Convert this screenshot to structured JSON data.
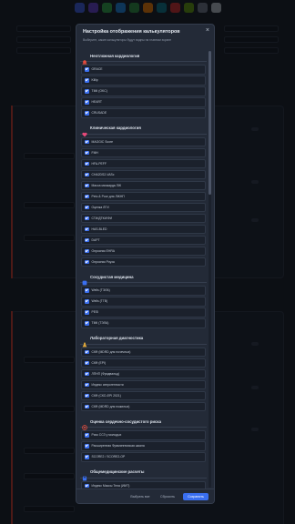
{
  "modal": {
    "title": "Настройка отображения калькуляторов",
    "subtitle": "Выберите, какие калькуляторы будут видны на главном экране",
    "close_symbol": "×"
  },
  "sections": [
    {
      "title": "Неотложная кардиология",
      "icon": "siren-icon",
      "icon_color": "#e74c3c",
      "items": [
        "GRACE",
        "Killip",
        "TIMI (OKC)",
        "HEART",
        "CRUSADE"
      ]
    },
    {
      "title": "Клиническая кардиология",
      "icon": "heart-icon",
      "icon_color": "#e84a7a",
      "items": [
        "MAGGIC Score",
        "FMH",
        "HFA-PEFF",
        "CHA2DS2-VASc",
        "Масса миокарда ЛЖ",
        "Peto & Poor для ЛЖНП",
        "Оценка ЛГИ",
        "СТИ/ДТКИ/ФИ",
        "HAS-BLED",
        "DAPT",
        "Опросник EHRA",
        "Опросник Роуза"
      ]
    },
    {
      "title": "Сосудистая медицина",
      "icon": "vessel-icon",
      "icon_color": "#3a6ff0",
      "items": [
        "Wells (ТЭЛА)",
        "Wells (ТГВ)",
        "PESI",
        "TIMI (ТЭЛА)"
      ]
    },
    {
      "title": "Лабораторная диагностика",
      "icon": "flask-icon",
      "icon_color": "#e0a83b",
      "items": [
        "СКФ (MDRD для почечных)",
        "СКФ (EPI)",
        "ЛПНП (Фридвальд)",
        "Индекс атерогенности",
        "СКФ (CKD-EPI 2021)",
        "СКФ (MDRD для пожилых)"
      ]
    },
    {
      "title": "Оценка сердечно-сосудистого риска",
      "icon": "target-icon",
      "icon_color": "#e74c3c",
      "items": [
        "Риск ССЗ у молодых",
        "Расширенная Фрамингемская шкала",
        "SCORE2 / SCORE2-OP"
      ]
    },
    {
      "title": "Общемедицинские расчеты",
      "icon": "calc-icon",
      "icon_color": "#3a6ff0",
      "items": [
        "Индекс Массы Тела (ИМТ)",
        "Площадь Поверхности Тела (ППТ)"
      ]
    }
  ],
  "footer": {
    "select_all_label": "Выбрать все",
    "reset_label": "Сбросить",
    "save_label": "Сохранить"
  },
  "colors": {
    "accent": "#3a6ff0",
    "modal_bg": "#232a37",
    "page_bg": "#161b24"
  }
}
